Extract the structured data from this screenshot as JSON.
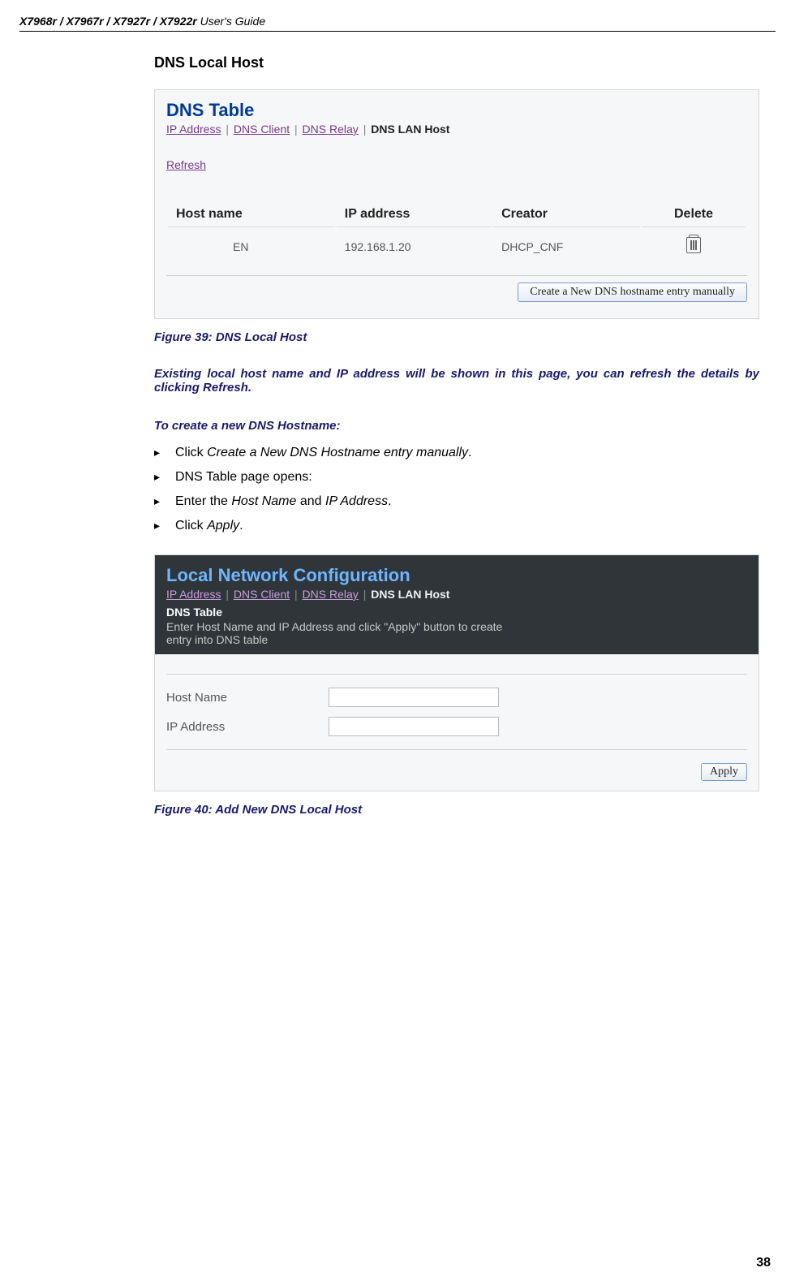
{
  "header_models": "X7968r / X7967r / X7927r / X7922r",
  "header_suffix": " User's Guide",
  "section_title": "DNS Local Host",
  "fig1": {
    "panel_title": "DNS Table",
    "tabs": {
      "ip": "IP Address",
      "client": "DNS Client",
      "relay": "DNS Relay",
      "active": "DNS LAN Host"
    },
    "refresh": "Refresh",
    "cols": {
      "host": "Host name",
      "ip": "IP address",
      "creator": "Creator",
      "del": "Delete"
    },
    "row": {
      "host": "EN",
      "ip": "192.168.1.20",
      "creator": "DHCP_CNF"
    },
    "create_btn": "Create a New DNS hostname entry manually"
  },
  "caption1": "Figure 39: DNS Local Host",
  "para1": "Existing local host name and IP address will be shown in this page, you can refresh the details by clicking Refresh.",
  "subhead": "To create a new DNS Hostname:",
  "steps": {
    "s1a": "Click ",
    "s1b": "Create a New DNS Hostname entry manually",
    "s1c": ".",
    "s2": "DNS Table page opens:",
    "s3a": "Enter the ",
    "s3b": "Host Name",
    "s3c": " and ",
    "s3d": "IP Address",
    "s3e": ".",
    "s4a": "Click ",
    "s4b": "Apply",
    "s4c": "."
  },
  "fig2": {
    "panel_title": "Local Network Configuration",
    "tabs": {
      "ip": "IP Address",
      "client": "DNS Client",
      "relay": "DNS Relay",
      "active": "DNS LAN Host"
    },
    "sub_title": "DNS Table",
    "help": "Enter Host Name and IP Address and click \"Apply\" button to create entry into DNS table",
    "host_lbl": "Host Name",
    "ip_lbl": "IP Address",
    "apply": "Apply"
  },
  "caption2": "Figure 40: Add New DNS Local Host",
  "pagenum": "38"
}
